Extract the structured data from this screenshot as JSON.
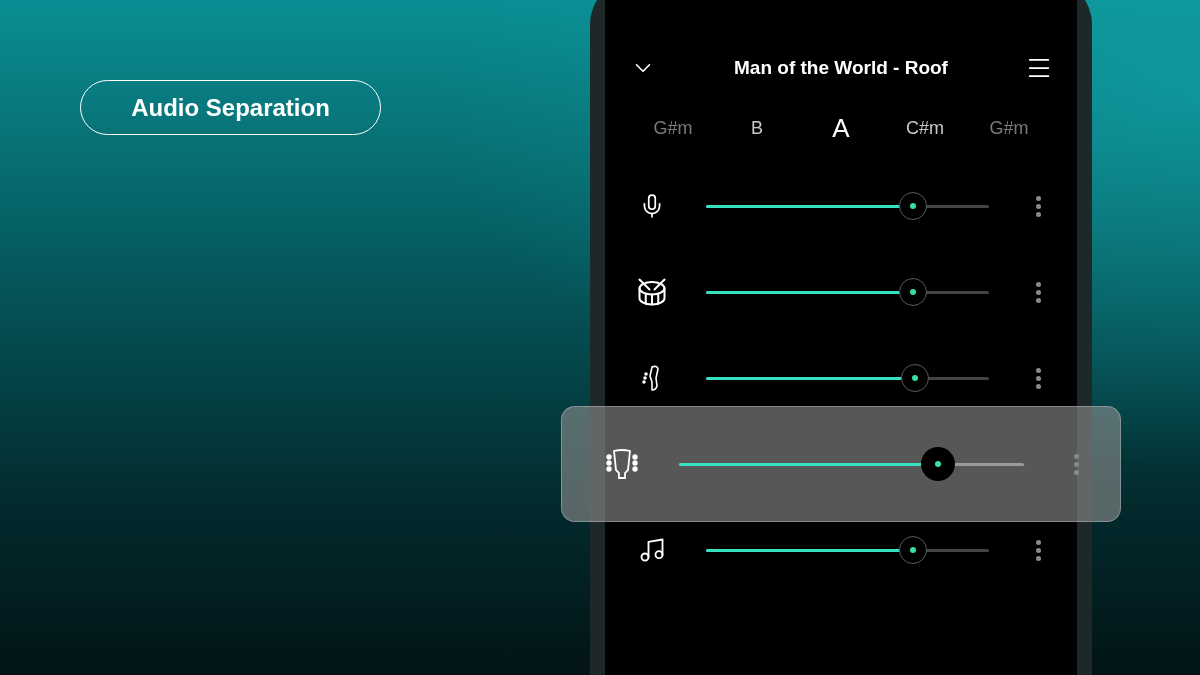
{
  "badge": {
    "label": "Audio Separation"
  },
  "player": {
    "title": "Man of the World - Roof",
    "chords": [
      {
        "label": "G#m",
        "selected": false
      },
      {
        "label": "B",
        "selected": false
      },
      {
        "label": "A",
        "selected": true
      },
      {
        "label": "C#m",
        "selected": false
      },
      {
        "label": "G#m",
        "selected": false
      }
    ],
    "tracks": [
      {
        "kind": "vocals",
        "level": 0.73,
        "selected": false
      },
      {
        "kind": "drums",
        "level": 0.73,
        "selected": false
      },
      {
        "kind": "bass",
        "level": 0.74,
        "selected": false
      },
      {
        "kind": "guitar",
        "level": 0.75,
        "selected": true
      },
      {
        "kind": "other",
        "level": 0.73,
        "selected": false
      }
    ]
  }
}
